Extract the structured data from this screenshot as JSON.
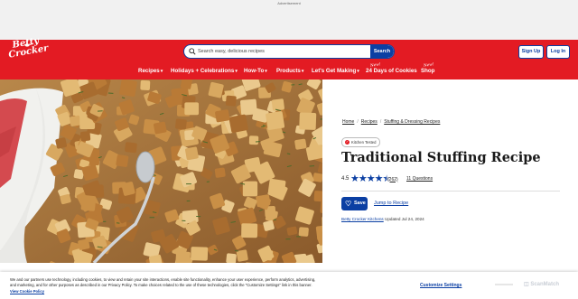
{
  "ad": {
    "label": "Advertisement"
  },
  "brand": {
    "line1": "Betty",
    "line2": "Crocker",
    "red": "#e31b23",
    "blue": "#0b3fa3"
  },
  "search": {
    "placeholder": "Search easy, delicious recipes",
    "button": "Search"
  },
  "auth": {
    "signup": "Sign Up",
    "login": "Log In"
  },
  "nav": {
    "items": [
      {
        "label": "Recipes",
        "has_chevron": true
      },
      {
        "label": "Holidays + Celebrations",
        "has_chevron": true
      },
      {
        "label": "How-To",
        "has_chevron": true
      },
      {
        "label": "Products",
        "has_chevron": true
      },
      {
        "label": "Let's Get Making",
        "has_chevron": true
      },
      {
        "label": "24 Days of Cookies",
        "tag": "New!"
      },
      {
        "label": "Shop",
        "tag": "New!"
      }
    ]
  },
  "breadcrumb": [
    "Home",
    "Recipes",
    "Stuffing & Dressing Recipes"
  ],
  "badge": {
    "label": "Kitchen Tested",
    "icon": "check-icon"
  },
  "recipe": {
    "title": "Traditional Stuffing Recipe",
    "rating": "4.5",
    "stars_filled": 4.5,
    "review_count": "(262)",
    "questions": "11 Questions",
    "save_label": "Save",
    "jump_label": "Jump to Recipe",
    "author": "Betty Crocker Kitchens",
    "updated": "Updated Jul 24, 2024"
  },
  "cookie": {
    "text": "We and our partners use technology, including cookies, to view and retain your site interactions, enable site functionality, enhance your user experience, perform analytics, advertising, and marketing, and for other purposes as described in our Privacy Policy. To make choices related to the use of these technologies, click the \"Customize Settings\" link in this banner.",
    "policy_link": "View Cookie Policy",
    "customize": "Customize Settings"
  },
  "watermark": "ScanMatch"
}
